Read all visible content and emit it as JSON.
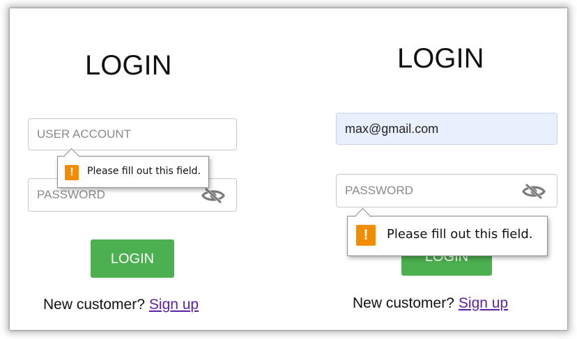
{
  "left_panel": {
    "title": "LOGIN",
    "user_field": {
      "value": "",
      "placeholder": "USER ACCOUNT"
    },
    "password_field": {
      "value": "",
      "placeholder": "PASSWORD",
      "toggle_icon": "eye-off-icon"
    },
    "login_button": "LOGIN",
    "validation_tooltip": {
      "icon": "warning-icon",
      "message": "Please fill out this field."
    },
    "footer": {
      "text": "New customer?",
      "link": "Sign up"
    }
  },
  "right_panel": {
    "title": "LOGIN",
    "user_field": {
      "value": "max@gmail.com",
      "placeholder": ""
    },
    "password_field": {
      "value": "",
      "placeholder": "PASSWORD",
      "toggle_icon": "eye-off-icon"
    },
    "login_button": "LOGIN",
    "validation_tooltip": {
      "icon": "warning-icon",
      "message": "Please fill out this field."
    },
    "footer": {
      "text": "New customer?",
      "link": "Sign up"
    }
  },
  "colors": {
    "button": "#4caf50",
    "warning": "#f28c00",
    "link": "#5b1fa8",
    "autofill": "#e8f0fe"
  }
}
